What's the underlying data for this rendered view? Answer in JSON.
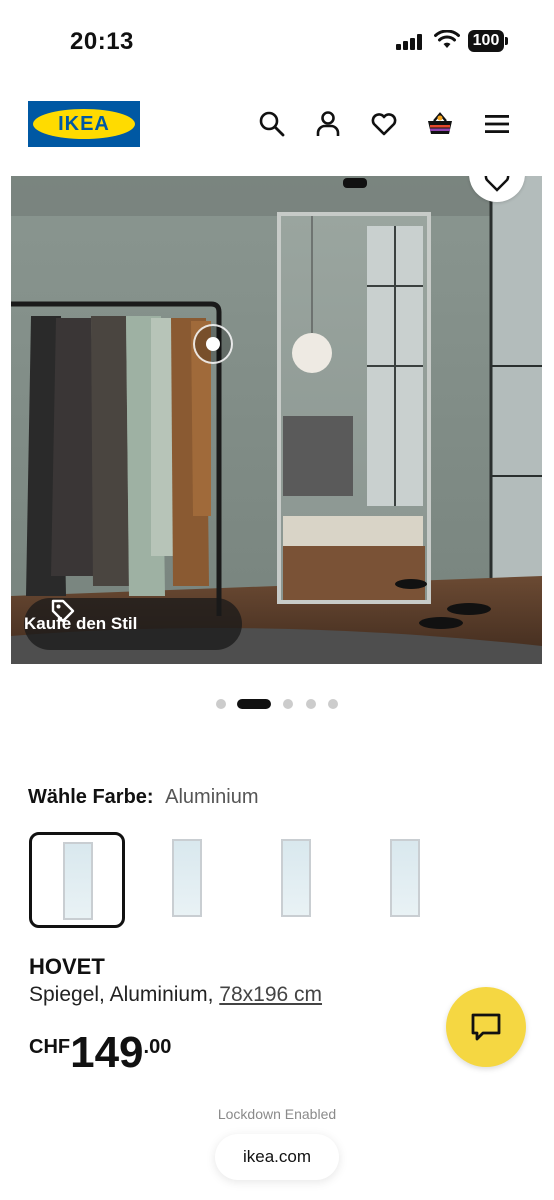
{
  "status_bar": {
    "time": "20:13",
    "battery": "100"
  },
  "header": {
    "logo_text": "IKEA",
    "icons": [
      "search-icon",
      "account-icon",
      "heart-icon",
      "basket-icon",
      "menu-icon"
    ]
  },
  "hero": {
    "shop_the_look_label": "Kaufe den Stil",
    "carousel": {
      "total": 5,
      "active_index": 2
    }
  },
  "color": {
    "label": "Wähle Farbe:",
    "selected_value": "Aluminium",
    "swatch_count": 4,
    "selected_index": 1
  },
  "product": {
    "name": "HOVET",
    "description": "Spiegel, Aluminium,",
    "size": "78x196 cm",
    "currency": "CHF",
    "price_int": "149",
    "price_dec": ".00"
  },
  "browser": {
    "lockdown": "Lockdown Enabled",
    "url": "ikea.com"
  },
  "colors": {
    "brand_blue": "#0058a3",
    "brand_yellow": "#ffdb00",
    "chat_yellow": "#f5d742"
  }
}
